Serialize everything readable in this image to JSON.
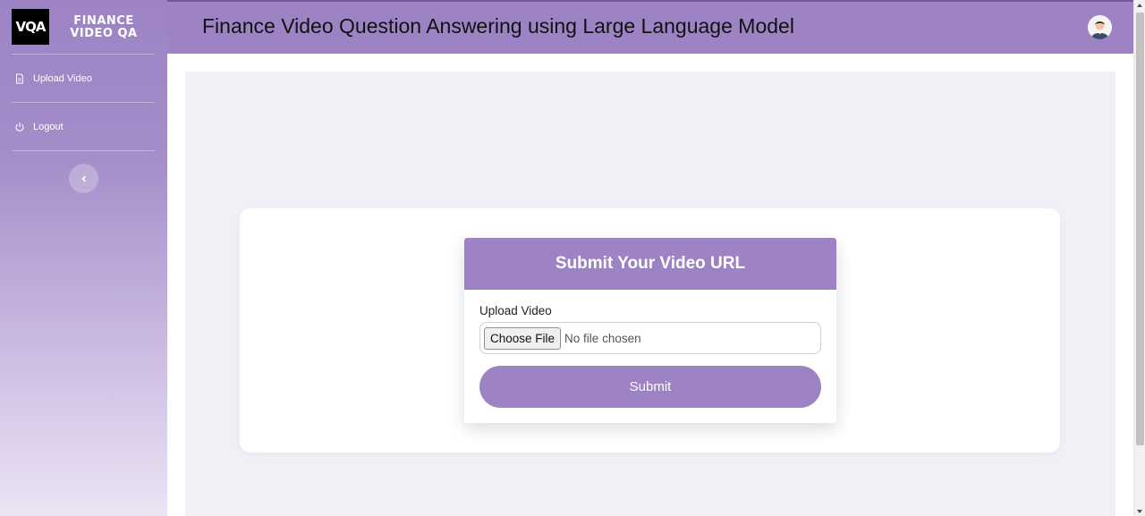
{
  "brand": {
    "logo_text": "VQA",
    "name_line1": "FINANCE",
    "name_line2": "VIDEO QA"
  },
  "sidebar": {
    "items": [
      {
        "label": "Upload Video",
        "icon": "document-icon"
      },
      {
        "label": "Logout",
        "icon": "power-icon"
      }
    ],
    "collapse_icon": "chevron-left-icon"
  },
  "header": {
    "title": "Finance Video Question Answering using Large Language Model",
    "avatar_icon": "user-avatar-icon"
  },
  "form": {
    "title": "Submit Your Video URL",
    "field_label": "Upload Video",
    "choose_button_label": "Choose File",
    "file_status": "No file chosen",
    "submit_label": "Submit"
  },
  "colors": {
    "accent": "#9d83c4",
    "main_background": "#eff1f6"
  }
}
